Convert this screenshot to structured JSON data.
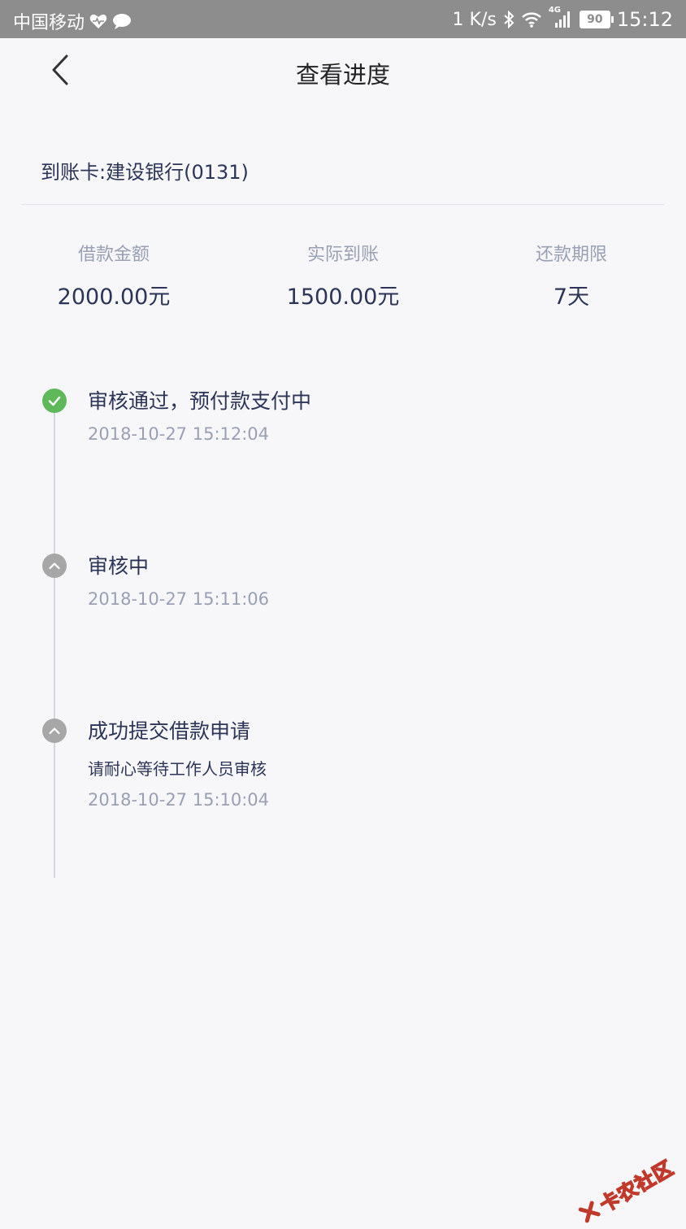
{
  "status_bar": {
    "carrier": "中国移动",
    "speed": "1 K/s",
    "network_label": "4G",
    "battery": "90",
    "time": "15:12"
  },
  "nav": {
    "title": "查看进度"
  },
  "card": {
    "text": "到账卡:建设银行(0131)"
  },
  "summary": [
    {
      "label": "借款金额",
      "value": "2000.00元"
    },
    {
      "label": "实际到账",
      "value": "1500.00元"
    },
    {
      "label": "还款期限",
      "value": "7天"
    }
  ],
  "timeline": [
    {
      "title": "审核通过，预付款支付中",
      "note": "",
      "time": "2018-10-27 15:12:04",
      "status": "done"
    },
    {
      "title": "审核中",
      "note": "",
      "time": "2018-10-27 15:11:06",
      "status": "pending"
    },
    {
      "title": "成功提交借款申请",
      "note": "请耐心等待工作人员审核",
      "time": "2018-10-27 15:10:04",
      "status": "pending"
    }
  ],
  "watermark": {
    "text": "卡农社区"
  },
  "colors": {
    "status_bar_bg": "#8d8d8d",
    "page_bg": "#f7f7f9",
    "primary_text": "#2c3558",
    "secondary_text": "#9aa0b4",
    "done_dot": "#5fb85a",
    "pending_dot": "#a7a7a7"
  },
  "icons": {
    "heart": "heart-pulse-icon",
    "chat": "chat-bubble-icon",
    "bluetooth": "bluetooth-icon",
    "wifi": "wifi-icon",
    "signal": "signal-icon",
    "back": "back-chevron-icon",
    "check": "check-icon",
    "up": "chevron-up-icon"
  }
}
